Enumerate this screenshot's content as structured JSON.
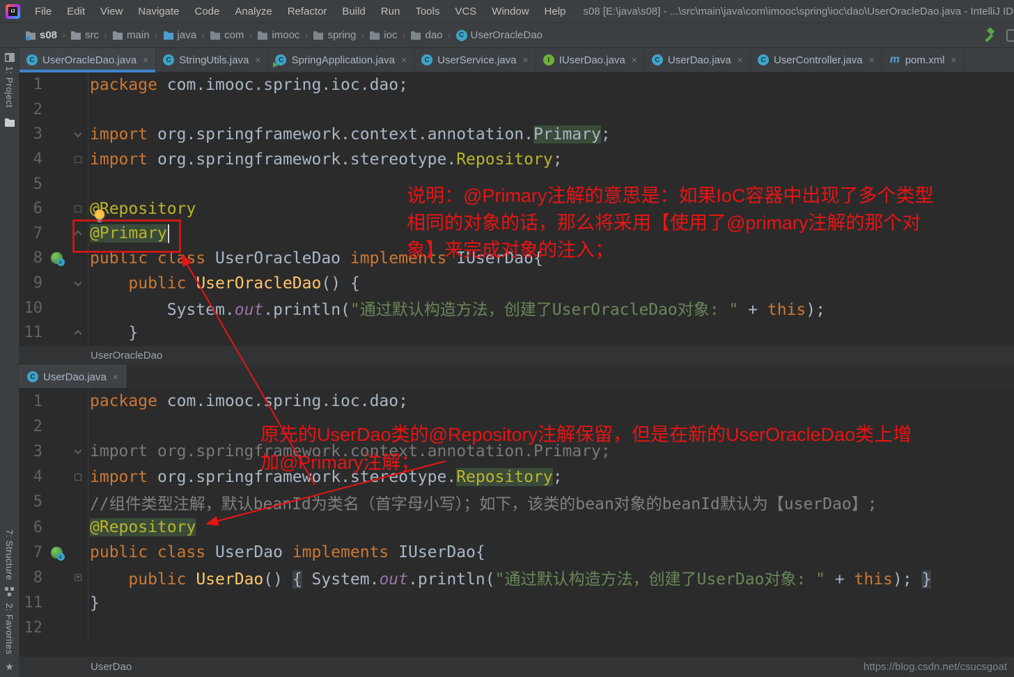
{
  "window": {
    "title": "s08 [E:\\java\\s08] - ...\\src\\main\\java\\com\\imooc\\spring\\ioc\\dao\\UserOracleDao.java - IntelliJ ID"
  },
  "menu": {
    "items": [
      "File",
      "Edit",
      "View",
      "Navigate",
      "Code",
      "Analyze",
      "Refactor",
      "Build",
      "Run",
      "Tools",
      "VCS",
      "Window",
      "Help"
    ]
  },
  "breadcrumbs": {
    "items": [
      {
        "label": "s08",
        "icon": "module"
      },
      {
        "label": "src",
        "icon": "folder"
      },
      {
        "label": "main",
        "icon": "folder"
      },
      {
        "label": "java",
        "icon": "source-folder"
      },
      {
        "label": "com",
        "icon": "package"
      },
      {
        "label": "imooc",
        "icon": "package"
      },
      {
        "label": "spring",
        "icon": "package"
      },
      {
        "label": "ioc",
        "icon": "package"
      },
      {
        "label": "dao",
        "icon": "package"
      },
      {
        "label": "UserOracleDao",
        "icon": "class"
      }
    ]
  },
  "rail": {
    "top": [
      {
        "label": "1: Project",
        "icon": "project-icon"
      }
    ],
    "bottom": [
      {
        "label": "7: Structure",
        "icon": "structure-icon"
      },
      {
        "label": "2: Favorites",
        "icon": "favorites-star-icon"
      }
    ]
  },
  "editor1_tabs": [
    {
      "label": "UserOracleDao.java",
      "icon": "class",
      "active": true
    },
    {
      "label": "StringUtils.java",
      "icon": "class",
      "active": false
    },
    {
      "label": "SpringApplication.java",
      "icon": "class-run",
      "active": false
    },
    {
      "label": "UserService.java",
      "icon": "class",
      "active": false
    },
    {
      "label": "IUserDao.java",
      "icon": "interface",
      "active": false
    },
    {
      "label": "UserDao.java",
      "icon": "class",
      "active": false
    },
    {
      "label": "UserController.java",
      "icon": "class",
      "active": false
    },
    {
      "label": "pom.xml",
      "icon": "maven",
      "active": false
    }
  ],
  "editor2_tabs": [
    {
      "label": "UserDao.java",
      "icon": "class",
      "active": true
    }
  ],
  "editor1": {
    "breadcrumb": "UserOracleDao",
    "lines": [
      {
        "num": "1",
        "tokens": [
          {
            "c": "kw",
            "s": "package"
          },
          {
            "c": "id",
            "s": " com.imooc.spring.ioc.dao;"
          }
        ]
      },
      {
        "num": "2",
        "tokens": []
      },
      {
        "num": "3",
        "fold": "down",
        "tokens": [
          {
            "c": "kw",
            "s": "import"
          },
          {
            "c": "id",
            "s": " org.springframework.context.annotation."
          },
          {
            "c": "id",
            "s": "Primary",
            "hl": true
          },
          {
            "c": "id",
            "s": ";"
          }
        ]
      },
      {
        "num": "4",
        "fold": "sq",
        "tokens": [
          {
            "c": "kw",
            "s": "import"
          },
          {
            "c": "id",
            "s": " org.springframework.stereotype."
          },
          {
            "c": "ann",
            "s": "Repository"
          },
          {
            "c": "id",
            "s": ";"
          }
        ]
      },
      {
        "num": "5",
        "tokens": []
      },
      {
        "num": "6",
        "fold": "sq",
        "tokens": [
          {
            "c": "ann",
            "s": "@Repository"
          }
        ]
      },
      {
        "num": "7",
        "fold": "up",
        "caret": true,
        "tokens": [
          {
            "c": "ann",
            "s": "@Primary",
            "hl": true
          }
        ]
      },
      {
        "num": "8",
        "gutter": "class",
        "tokens": [
          {
            "c": "kw",
            "s": "public class"
          },
          {
            "c": "id",
            "s": " UserOracleDao "
          },
          {
            "c": "kw",
            "s": "implements"
          },
          {
            "c": "id",
            "s": " IUserDao{"
          }
        ]
      },
      {
        "num": "9",
        "fold": "down",
        "tokens": [
          {
            "c": "id",
            "s": "    "
          },
          {
            "c": "kw",
            "s": "public"
          },
          {
            "c": "mth",
            "s": " UserOracleDao"
          },
          {
            "c": "id",
            "s": "() {"
          }
        ]
      },
      {
        "num": "10",
        "tokens": [
          {
            "c": "id",
            "s": "        System."
          },
          {
            "c": "fld",
            "s": "out"
          },
          {
            "c": "id",
            "s": ".println("
          },
          {
            "c": "str",
            "s": "\"通过默认构造方法，创建了UserOracleDao对象: \""
          },
          {
            "c": "id",
            "s": " + "
          },
          {
            "c": "kw",
            "s": "this"
          },
          {
            "c": "id",
            "s": ");"
          }
        ]
      },
      {
        "num": "11",
        "fold": "up",
        "tokens": [
          {
            "c": "id",
            "s": "    }"
          }
        ]
      }
    ]
  },
  "editor2": {
    "breadcrumb": "UserDao",
    "lines": [
      {
        "num": "1",
        "tokens": [
          {
            "c": "kw",
            "s": "package"
          },
          {
            "c": "id",
            "s": " com.imooc.spring.ioc.dao;"
          }
        ]
      },
      {
        "num": "2",
        "tokens": []
      },
      {
        "num": "3",
        "fold": "down",
        "tokens": [
          {
            "c": "gray",
            "s": "import org.springframework.context.annotation.Primary;"
          }
        ]
      },
      {
        "num": "4",
        "fold": "sq",
        "tokens": [
          {
            "c": "kw",
            "s": "import"
          },
          {
            "c": "id",
            "s": " org.springframework.stereotype."
          },
          {
            "c": "ann",
            "s": "Repository",
            "hl": true
          },
          {
            "c": "id",
            "s": ";"
          }
        ]
      },
      {
        "num": "5",
        "tokens": [
          {
            "c": "cmt",
            "s": "//组件类型注解，默认beanId为类名（首字母小写）；如下，该类的bean对象的beanId默认为【userDao】;"
          }
        ]
      },
      {
        "num": "6",
        "tokens": [
          {
            "c": "ann",
            "s": "@Repository",
            "hl": true
          }
        ]
      },
      {
        "num": "7",
        "gutter": "class",
        "tokens": [
          {
            "c": "kw",
            "s": "public class"
          },
          {
            "c": "id",
            "s": " UserDao "
          },
          {
            "c": "kw",
            "s": "implements"
          },
          {
            "c": "id",
            "s": " IUserDao{"
          }
        ]
      },
      {
        "num": "8",
        "fold": "plus",
        "tokens": [
          {
            "c": "id",
            "s": "    "
          },
          {
            "c": "kw",
            "s": "public"
          },
          {
            "c": "mth",
            "s": " UserDao"
          },
          {
            "c": "id",
            "s": "() "
          },
          {
            "c": "fold",
            "s": "{"
          },
          {
            "c": "id",
            "s": " System."
          },
          {
            "c": "fld",
            "s": "out"
          },
          {
            "c": "id",
            "s": ".println("
          },
          {
            "c": "str",
            "s": "\"通过默认构造方法，创建了UserDao对象: \""
          },
          {
            "c": "id",
            "s": " + "
          },
          {
            "c": "kw",
            "s": "this"
          },
          {
            "c": "id",
            "s": "); "
          },
          {
            "c": "fold",
            "s": "}"
          }
        ]
      },
      {
        "num": "11",
        "tokens": [
          {
            "c": "id",
            "s": "}"
          }
        ]
      },
      {
        "num": "12",
        "tokens": []
      }
    ]
  },
  "notes": {
    "note1": [
      "说明：@Primary注解的意思是：如果IoC容器中出现了多个类型",
      "相同的对象的话，那么将采用【使用了@primary注解的那个对",
      "象】来完成对象的注入；"
    ],
    "note2": [
      "原先的UserDao类的@Repository注解保留，但是在新的UserOracleDao类上增",
      "加@Primary注解；"
    ]
  },
  "watermark": "https://blog.csdn.net/csucsgoat",
  "colors": {
    "accent_red": "#E81414",
    "tab_underline": "#4083C9",
    "annotation_yellow": "#BBB529",
    "string_green": "#6A8759"
  }
}
